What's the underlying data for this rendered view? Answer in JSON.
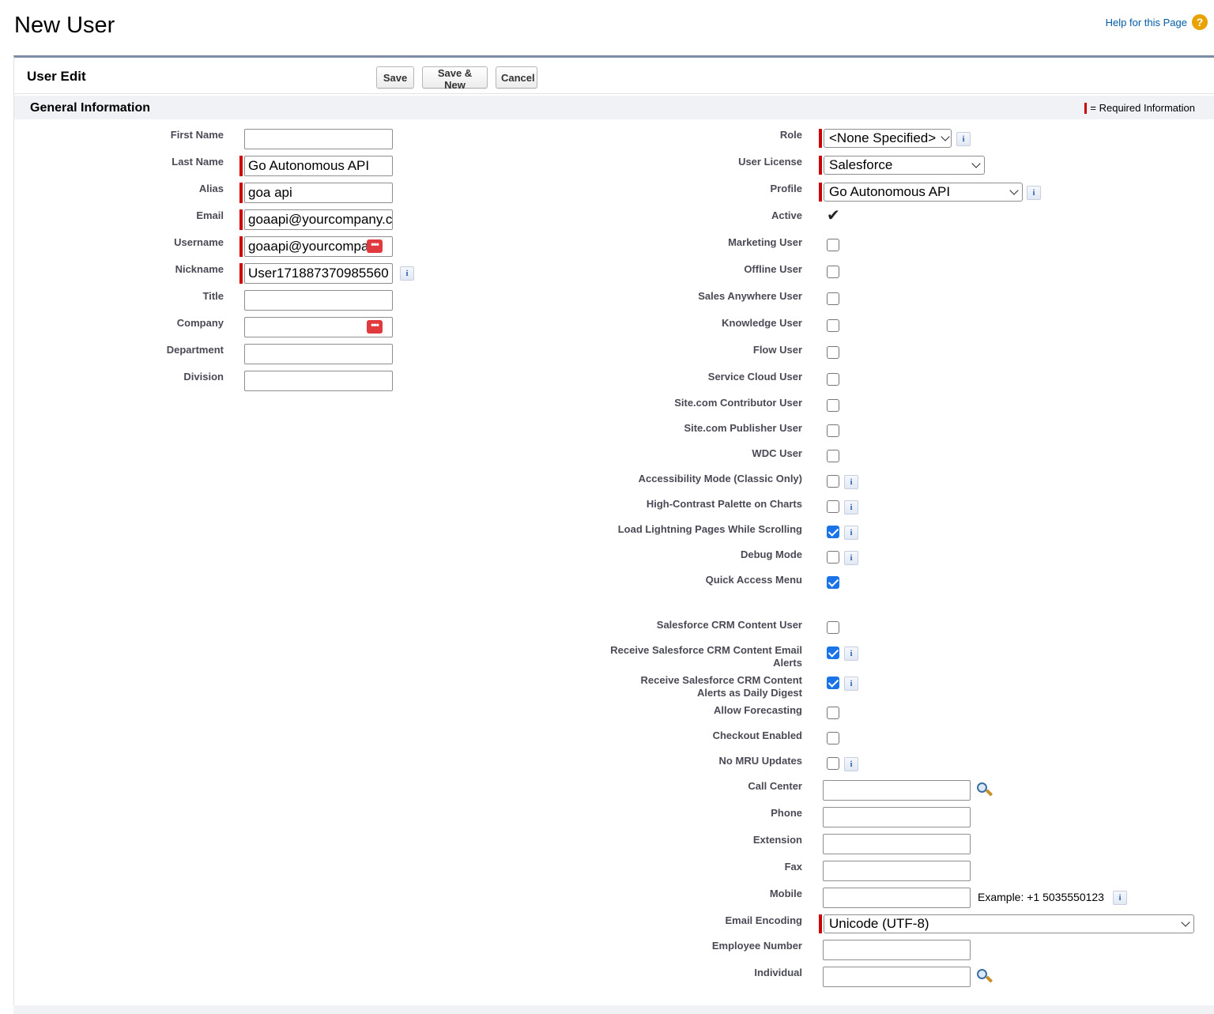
{
  "page": {
    "title": "New User",
    "help_link": "Help for this Page",
    "help_icon": "?"
  },
  "panel": {
    "title": "User Edit",
    "buttons": {
      "save": "Save",
      "save_new": "Save & New",
      "cancel": "Cancel"
    },
    "section_title": "General Information",
    "required_legend": "= Required Information"
  },
  "left_fields": {
    "first_name": {
      "label": "First Name",
      "value": ""
    },
    "last_name": {
      "label": "Last Name",
      "value": "Go Autonomous API"
    },
    "alias": {
      "label": "Alias",
      "value": "goa api"
    },
    "email": {
      "label": "Email",
      "value": "goaapi@yourcompany.c"
    },
    "username": {
      "label": "Username",
      "value": "goaapi@yourcompa"
    },
    "nickname": {
      "label": "Nickname",
      "value": "User171887370985560"
    },
    "title": {
      "label": "Title",
      "value": ""
    },
    "company": {
      "label": "Company",
      "value": ""
    },
    "department": {
      "label": "Department",
      "value": ""
    },
    "division": {
      "label": "Division",
      "value": ""
    }
  },
  "right_fields": {
    "role": {
      "label": "Role",
      "value": "<None Specified>"
    },
    "user_license": {
      "label": "User License",
      "value": "Salesforce"
    },
    "profile": {
      "label": "Profile",
      "value": "Go Autonomous API"
    },
    "active": {
      "label": "Active",
      "checked": true
    },
    "marketing_user": {
      "label": "Marketing User",
      "checked": false
    },
    "offline_user": {
      "label": "Offline User",
      "checked": false
    },
    "sales_anywhere_user": {
      "label": "Sales Anywhere User",
      "checked": false
    },
    "knowledge_user": {
      "label": "Knowledge User",
      "checked": false
    },
    "flow_user": {
      "label": "Flow User",
      "checked": false
    },
    "service_cloud_user": {
      "label": "Service Cloud User",
      "checked": false
    },
    "site_contributor": {
      "label": "Site.com Contributor User",
      "checked": false
    },
    "site_publisher": {
      "label": "Site.com Publisher User",
      "checked": false
    },
    "wdc_user": {
      "label": "WDC User",
      "checked": false
    },
    "accessibility_mode": {
      "label": "Accessibility Mode (Classic Only)",
      "checked": false
    },
    "high_contrast": {
      "label": "High-Contrast Palette on Charts",
      "checked": false
    },
    "load_lightning": {
      "label": "Load Lightning Pages While Scrolling",
      "checked": true
    },
    "debug_mode": {
      "label": "Debug Mode",
      "checked": false
    },
    "quick_access": {
      "label": "Quick Access Menu",
      "checked": true
    },
    "crm_content_user": {
      "label": "Salesforce CRM Content User",
      "checked": false
    },
    "crm_email_alerts": {
      "label_line1": "Receive Salesforce CRM Content Email",
      "label_line2": "Alerts",
      "checked": true
    },
    "crm_daily_digest": {
      "label_line1": "Receive Salesforce CRM Content",
      "label_line2": "Alerts as Daily Digest",
      "checked": true
    },
    "allow_forecasting": {
      "label": "Allow Forecasting",
      "checked": false
    },
    "checkout_enabled": {
      "label": "Checkout Enabled",
      "checked": false
    },
    "no_mru_updates": {
      "label": "No MRU Updates",
      "checked": false
    },
    "call_center": {
      "label": "Call Center",
      "value": ""
    },
    "phone": {
      "label": "Phone",
      "value": ""
    },
    "extension": {
      "label": "Extension",
      "value": ""
    },
    "fax": {
      "label": "Fax",
      "value": ""
    },
    "mobile": {
      "label": "Mobile",
      "value": "",
      "example": "Example: +1 5035550123"
    },
    "email_encoding": {
      "label": "Email Encoding",
      "value": "Unicode (UTF-8)"
    },
    "employee_number": {
      "label": "Employee Number",
      "value": ""
    },
    "individual": {
      "label": "Individual",
      "value": ""
    }
  },
  "info_icon": "i",
  "password_icon": "•••",
  "colors": {
    "required": "#cc0000",
    "link": "#015ba7",
    "checkbox": "#1a73e8",
    "section_bg": "#f0f2f5"
  }
}
